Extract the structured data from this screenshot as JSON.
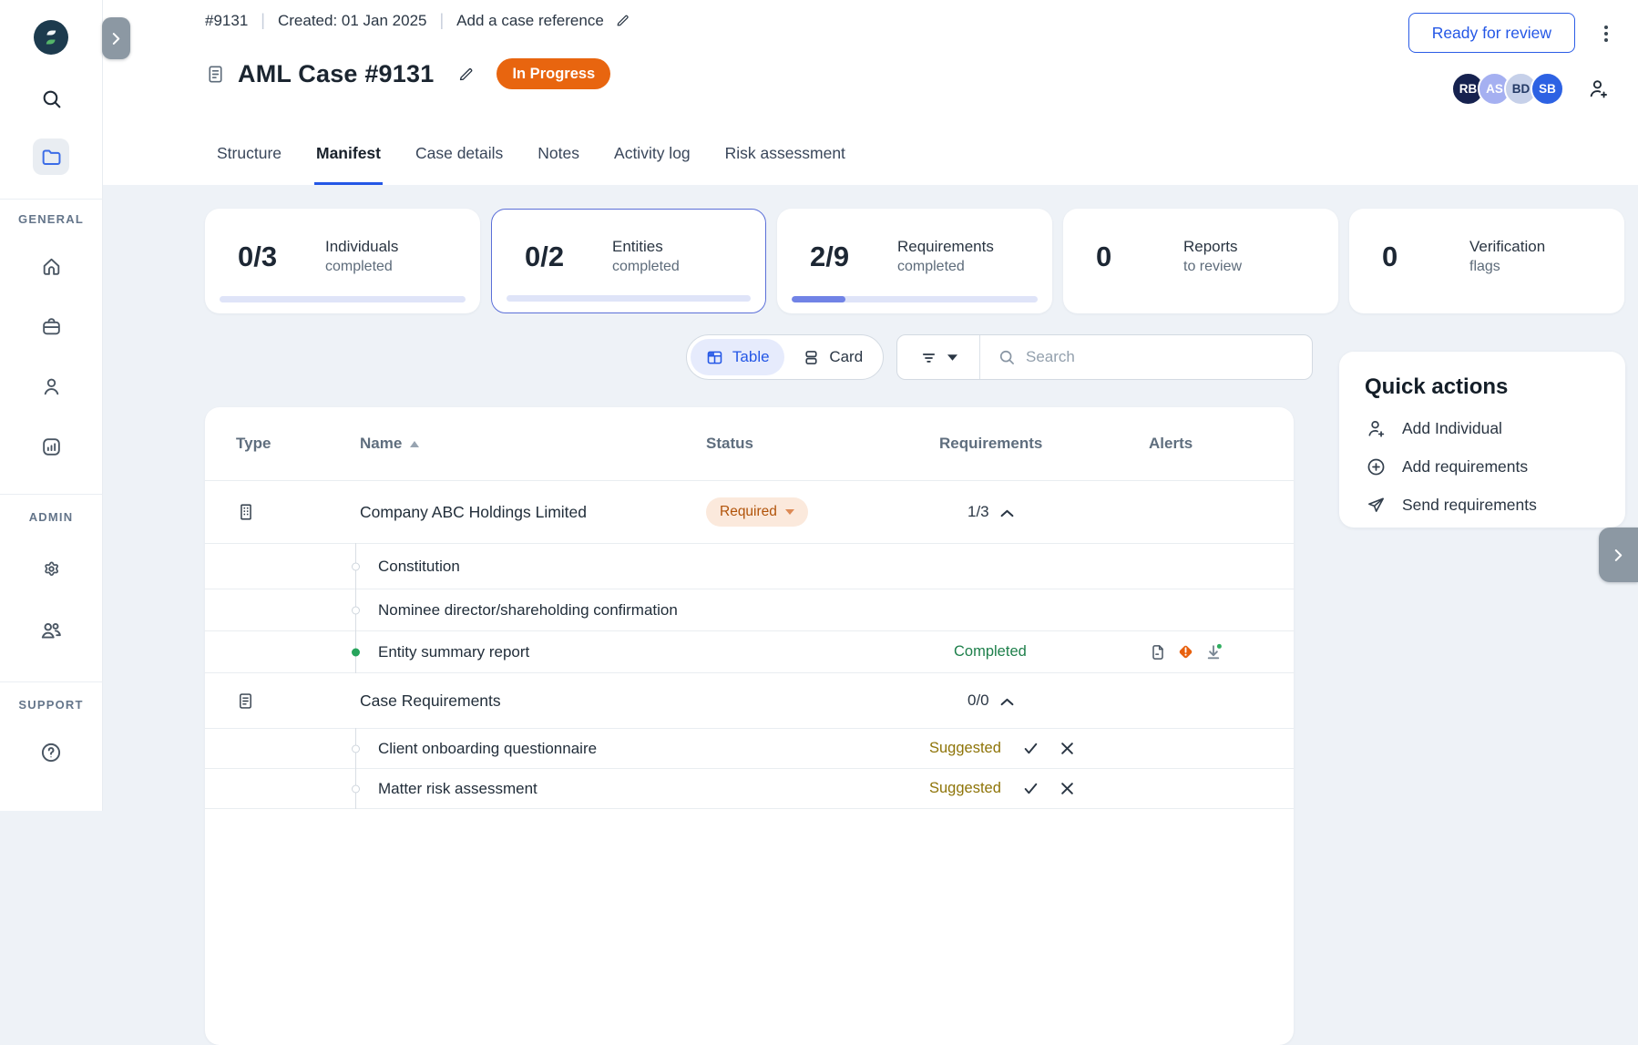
{
  "sidebar": {
    "sections": [
      {
        "label": "GENERAL"
      },
      {
        "label": "ADMIN"
      },
      {
        "label": "SUPPORT"
      }
    ]
  },
  "header": {
    "case_number": "#9131",
    "separator": "|",
    "created": "Created: 01 Jan 2025",
    "add_reference": "Add a case reference",
    "title": "AML Case #9131",
    "status": "In Progress",
    "ready_button": "Ready for review",
    "avatars": [
      {
        "initials": "RB",
        "bg": "#16224f",
        "fg": "#ffffff"
      },
      {
        "initials": "AS",
        "bg": "#a5b0f1",
        "fg": "#ffffff"
      },
      {
        "initials": "BD",
        "bg": "#c6d0e9",
        "fg": "#243a66"
      },
      {
        "initials": "SB",
        "bg": "#2d62e3",
        "fg": "#ffffff"
      }
    ]
  },
  "tabs": [
    {
      "label": "Structure",
      "active": false
    },
    {
      "label": "Manifest",
      "active": true
    },
    {
      "label": "Case details",
      "active": false
    },
    {
      "label": "Notes",
      "active": false
    },
    {
      "label": "Activity log",
      "active": false
    },
    {
      "label": "Risk assessment",
      "active": false
    }
  ],
  "stats": [
    {
      "value": "0/3",
      "label": "Individuals",
      "sublabel": "completed",
      "progress_pct": 0,
      "selected": false
    },
    {
      "value": "0/2",
      "label": "Entities",
      "sublabel": "completed",
      "progress_pct": 0,
      "selected": true
    },
    {
      "value": "2/9",
      "label": "Requirements",
      "sublabel": "completed",
      "progress_pct": 22,
      "selected": false
    },
    {
      "value": "0",
      "label": "Reports",
      "sublabel": "to review",
      "progress_pct": null,
      "selected": false
    },
    {
      "value": "0",
      "label": "Verification",
      "sublabel": "flags",
      "progress_pct": null,
      "selected": false
    }
  ],
  "toolbar": {
    "view_table": "Table",
    "view_card": "Card",
    "search_placeholder": "Search"
  },
  "quick_actions": {
    "title": "Quick actions",
    "items": [
      {
        "label": "Add Individual",
        "icon": "person-plus-icon"
      },
      {
        "label": "Add requirements",
        "icon": "plus-circle-icon"
      },
      {
        "label": "Send requirements",
        "icon": "send-icon"
      }
    ]
  },
  "table": {
    "columns": [
      "Type",
      "Name",
      "Status",
      "Requirements",
      "Alerts"
    ],
    "sorted_column": "Name",
    "sort_direction": "asc",
    "rows": [
      {
        "kind": "group",
        "type": "entity",
        "name": "Company ABC Holdings Limited",
        "status": "Required",
        "requirements": "1/3"
      },
      {
        "kind": "requirement",
        "name": "Constitution",
        "state": "pending"
      },
      {
        "kind": "requirement",
        "name": "Nominee director/shareholding confirmation",
        "state": "pending"
      },
      {
        "kind": "requirement",
        "name": "Entity summary report",
        "state": "completed",
        "status": "Completed",
        "alerts": [
          "report-icon",
          "warning-icon",
          "download-new-icon"
        ]
      },
      {
        "kind": "group",
        "type": "case",
        "name": "Case Requirements",
        "requirements": "0/0"
      },
      {
        "kind": "requirement",
        "name": "Client onboarding questionnaire",
        "state": "pending",
        "status": "Suggested",
        "suggest_actions": true
      },
      {
        "kind": "requirement",
        "name": "Matter risk assessment",
        "state": "pending",
        "status": "Suggested",
        "suggest_actions": true
      }
    ]
  },
  "colors": {
    "accent_blue": "#2457e6",
    "selected_card_border": "#5b6fd8",
    "progress_fill": "#7183e6",
    "progress_track": "#dfe4f8",
    "status_in_progress_bg": "#e8650f",
    "required_badge_bg": "#fbe9dc",
    "required_badge_text": "#b15309",
    "completed_green": "#1d7f4a",
    "suggested_amber": "#8e7408",
    "warning_orange": "#e8610f",
    "new_dot_green": "#2fae5f"
  }
}
